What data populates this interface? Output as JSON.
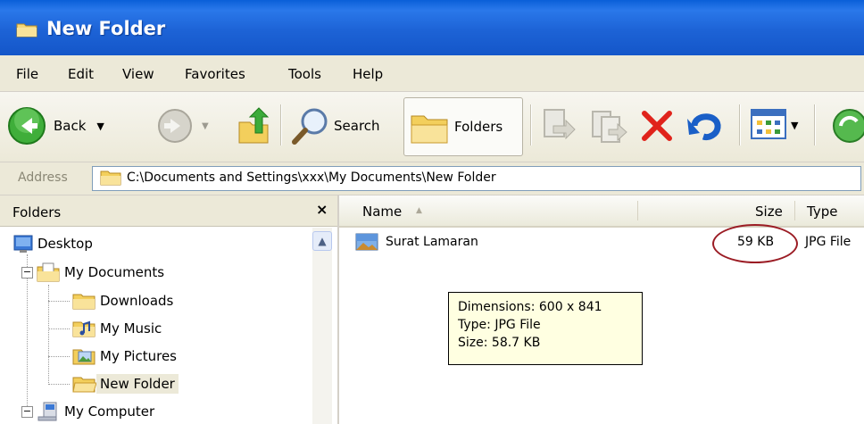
{
  "window": {
    "title": "New Folder"
  },
  "menu": [
    "File",
    "Edit",
    "View",
    "Favorites",
    "Tools",
    "Help"
  ],
  "toolbar": {
    "back_label": "Back",
    "search_label": "Search",
    "folders_label": "Folders"
  },
  "address": {
    "label": "Address",
    "value": "C:\\Documents and Settings\\xxx\\My Documents\\New Folder"
  },
  "folders_pane": {
    "title": "Folders",
    "close": "×",
    "tree": [
      {
        "label": "Desktop"
      },
      {
        "label": "My Documents"
      },
      {
        "label": "Downloads"
      },
      {
        "label": "My Music"
      },
      {
        "label": "My Pictures"
      },
      {
        "label": "New Folder"
      },
      {
        "label": "My Computer"
      }
    ]
  },
  "file_list": {
    "columns": {
      "name": "Name",
      "size": "Size",
      "type": "Type"
    },
    "files": [
      {
        "name": "Surat Lamaran",
        "size": "59 KB",
        "type": "JPG File"
      }
    ]
  },
  "tooltip": {
    "dimensions": "Dimensions: 600 x 841",
    "type": "Type: JPG File",
    "size": "Size: 58.7 KB"
  },
  "colors": {
    "titlebar": "#1d63d6",
    "chrome": "#ece9d8",
    "tooltip_bg": "#ffffe1",
    "annotation_oval": "#9b1c24"
  }
}
